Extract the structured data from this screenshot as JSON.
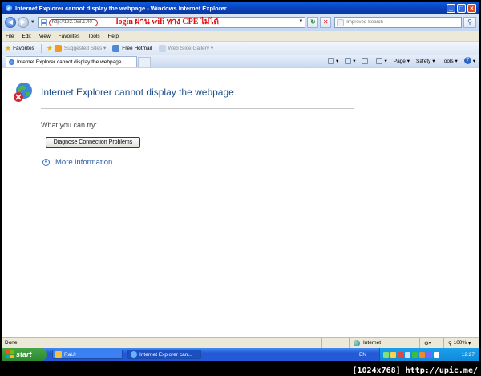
{
  "window": {
    "title": "Internet Explorer cannot display the webpage - Windows Internet Explorer"
  },
  "address_bar": {
    "url": "http://192.168.1.40",
    "annotation": "login ผ่าน wifi ทาง   CPE    ไม่ได้",
    "annotation_color": "#e01010",
    "search_placeholder": "Improved Search"
  },
  "menu": [
    "File",
    "Edit",
    "View",
    "Favorites",
    "Tools",
    "Help"
  ],
  "favorites_bar": {
    "favorites_label": "Favorites",
    "items": [
      "Suggested Sites ▾",
      "Free Hotmail",
      "Web Slice Gallery ▾"
    ]
  },
  "tab": {
    "label": "Internet Explorer cannot display the webpage"
  },
  "command_bar": {
    "page": "Page ▾",
    "safety": "Safety ▾",
    "tools": "Tools ▾"
  },
  "content": {
    "heading": "Internet Explorer cannot display the webpage",
    "try_label": "What you can try:",
    "diagnose_button": "Diagnose Connection Problems",
    "more_info": "More information",
    "heading_color": "#1f4e8c"
  },
  "status_bar": {
    "status": "Done",
    "zone": "Internet",
    "zoom": "100%"
  },
  "taskbar": {
    "start": "start",
    "tasks": [
      "RaUI",
      "Internet Explorer can..."
    ],
    "language": "EN",
    "clock": "12:27"
  },
  "watermark": "[1024x768] http://upic.me/"
}
